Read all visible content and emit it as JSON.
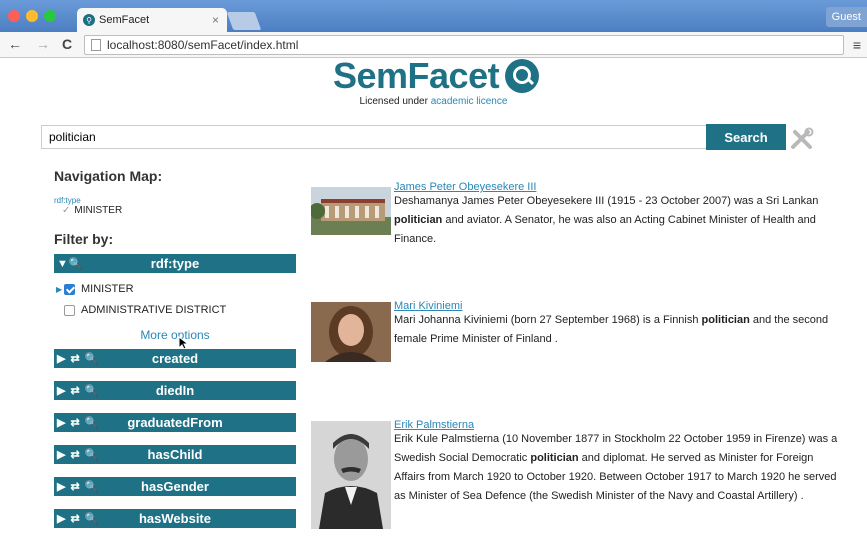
{
  "browser": {
    "tab_title": "SemFacet",
    "tab_close": "×",
    "guest_label": "Guest",
    "url": "localhost:8080/semFacet/index.html",
    "back": "←",
    "forward": "→",
    "reload": "C",
    "menu": "≡"
  },
  "header": {
    "logo_text": "SemFacet",
    "license_prefix": "Licensed under ",
    "license_link": "academic licence"
  },
  "search": {
    "value": "politician",
    "button_label": "Search"
  },
  "sidebar": {
    "nav_map_heading": "Navigation Map:",
    "nav_map_type": "rdf:type",
    "nav_map_value": "MINISTER",
    "filter_heading": "Filter by:",
    "type_facet": {
      "control": "▼🔍",
      "label": "rdf:type",
      "options": [
        {
          "label": "MINISTER",
          "checked": true
        },
        {
          "label": "ADMINISTRATIVE DISTRICT",
          "checked": false
        }
      ],
      "more": "More options"
    },
    "facets": [
      {
        "label": "created"
      },
      {
        "label": "diedIn"
      },
      {
        "label": "graduatedFrom"
      },
      {
        "label": "hasChild"
      },
      {
        "label": "hasGender"
      },
      {
        "label": "hasWebsite"
      }
    ],
    "facet_controls": "▶ ⇄ 🔍"
  },
  "results": [
    {
      "title": "James Peter Obeyesekere III",
      "snippet_html": "Deshamanya James Peter Obeyesekere III (1915 - 23 October 2007) was a Sri Lankan <b>politician</b> and aviator. A Senator, he was also an Acting Cabinet Minister of Health and Finance."
    },
    {
      "title": "Mari Kiviniemi",
      "snippet_html": "Mari Johanna Kiviniemi (born 27 September 1968) is a Finnish <b>politician</b> and the second female Prime Minister of Finland ."
    },
    {
      "title": "Erik Palmstierna",
      "snippet_html": "Erik Kule Palmstierna (10 November 1877 in Stockholm 22 October 1959 in Firenze) was a Swedish Social Democratic <b>politician</b> and diplomat. He served as Minister for Foreign Affairs from March 1920 to October 1920. Between October 1917 to March 1920 he served as Minister of Sea Defence (the Swedish Minister of the Navy and Coastal Artillery) ."
    }
  ],
  "colors": {
    "accent": "#1f7185",
    "link": "#2a87b6"
  }
}
